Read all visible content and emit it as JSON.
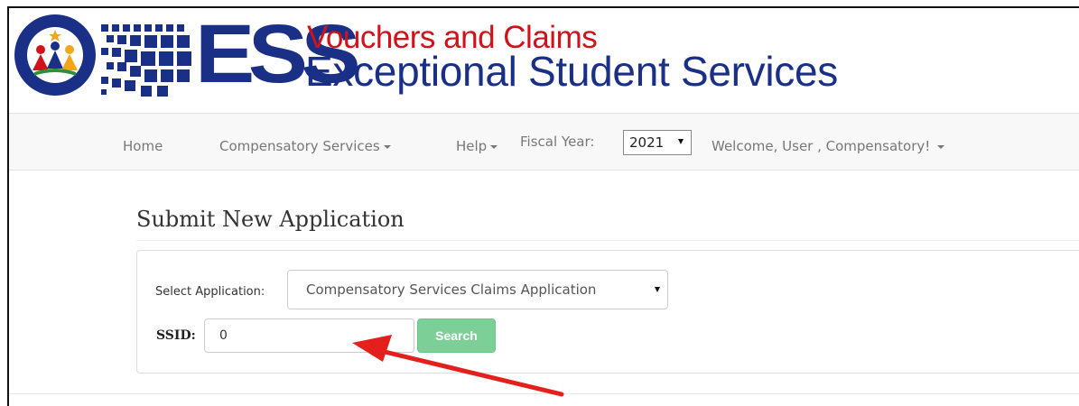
{
  "header": {
    "seal_text_top": "ARIZONA",
    "seal_text_bottom": "Department of Education",
    "ess": "ESS",
    "line1": "Vouchers and Claims",
    "line2": "Exceptional Student Services",
    "colors": {
      "navy": "#1a2f86",
      "red": "#d0121b"
    }
  },
  "nav": {
    "home": "Home",
    "compensatory": "Compensatory Services",
    "help": "Help",
    "fiscal_year_label": "Fiscal Year:",
    "fiscal_year_value": "2021",
    "welcome": "Welcome, User , Compensatory!"
  },
  "main": {
    "title": "Submit New Application",
    "select_label": "Select Application:",
    "select_value": "Compensatory Services Claims Application",
    "ssid_label": "SSID:",
    "ssid_value": "0",
    "search_label": "Search"
  },
  "annotation": {
    "arrow_color": "#e3201b"
  }
}
